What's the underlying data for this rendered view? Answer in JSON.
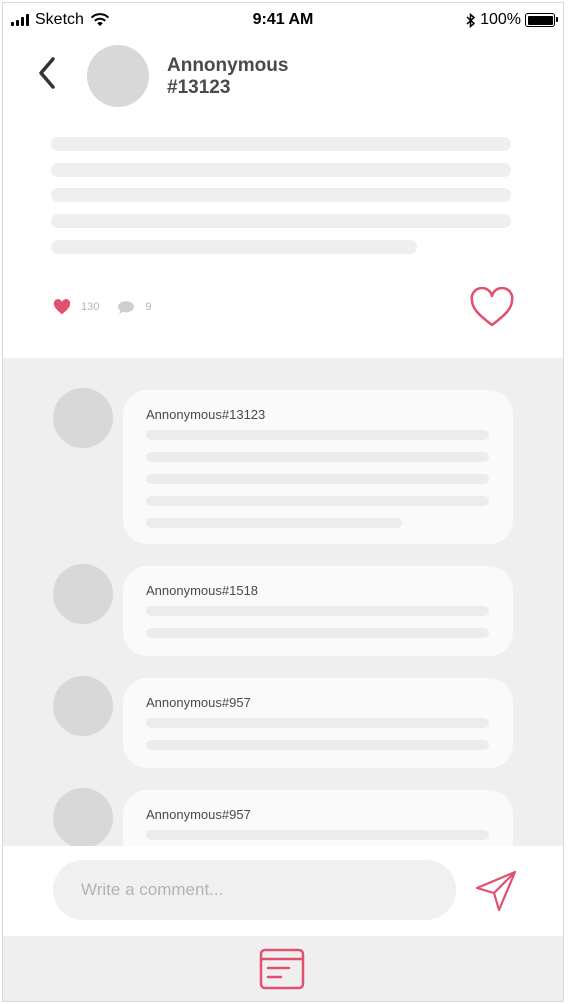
{
  "status_bar": {
    "carrier": "Sketch",
    "time": "9:41 AM",
    "battery_percent": "100%",
    "icons": [
      "signal-icon",
      "wifi-icon",
      "bluetooth-icon",
      "battery-icon"
    ]
  },
  "header": {
    "back_icon": "chevron-left-icon",
    "author_name_line1": "Annonymous",
    "author_name_line2": "#13123"
  },
  "post": {
    "like_count": "130",
    "comment_count": "9",
    "like_icon": "heart-icon",
    "comment_icon": "speech-bubble-icon",
    "favorite_icon": "heart-outline-icon"
  },
  "comments": [
    {
      "author": "Annonymous#13123"
    },
    {
      "author": "Annonymous#1518"
    },
    {
      "author": "Annonymous#957"
    },
    {
      "author": "Annonymous#957"
    }
  ],
  "comment_box": {
    "placeholder": "Write a comment...",
    "send_icon": "send-icon"
  },
  "bottom_nav": {
    "feed_icon": "feed-icon"
  },
  "colors": {
    "accent": "#e2506f",
    "placeholder_gray": "#efefef",
    "avatar_gray": "#d8d8d8"
  }
}
